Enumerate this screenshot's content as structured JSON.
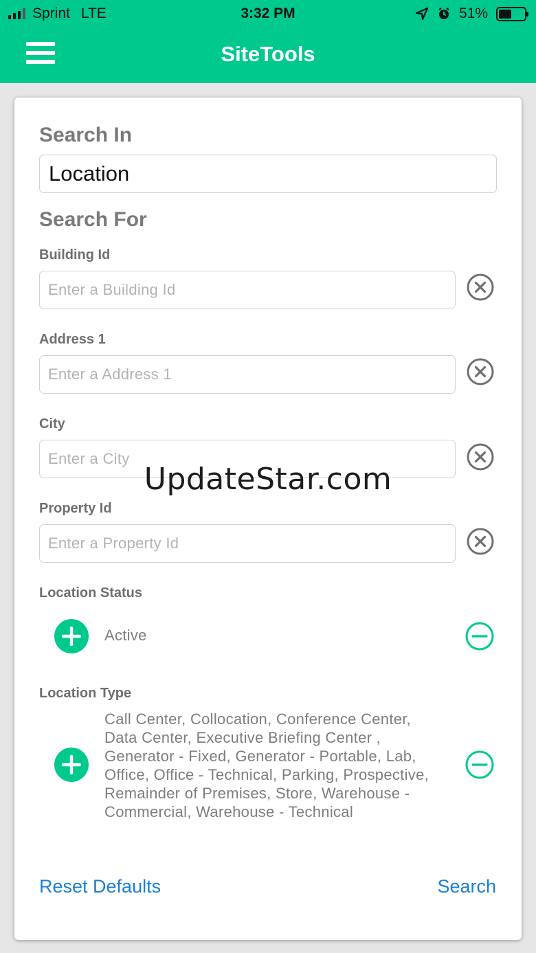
{
  "status_bar": {
    "carrier": "Sprint",
    "network": "LTE",
    "time": "3:32 PM",
    "battery_text": "51%",
    "battery_level": 0.51
  },
  "app": {
    "title": "SiteTools",
    "accent_color": "#00c98e",
    "link_color": "#1a7fd6",
    "menu_icon": "hamburger-menu-icon"
  },
  "search_in": {
    "label": "Search In",
    "value": "Location"
  },
  "search_for": {
    "label": "Search For",
    "fields": [
      {
        "label": "Building Id",
        "placeholder": "Enter a Building Id",
        "value": ""
      },
      {
        "label": "Address 1",
        "placeholder": "Enter a Address 1",
        "value": ""
      },
      {
        "label": "City",
        "placeholder": "Enter a City",
        "value": ""
      },
      {
        "label": "Property Id",
        "placeholder": "Enter a Property Id",
        "value": ""
      }
    ]
  },
  "location_status": {
    "label": "Location Status",
    "value": "Active"
  },
  "location_type": {
    "label": "Location Type",
    "lines": [
      "Call Center, Collocation, Conference Center,",
      "Data Center, Executive Briefing Center ,",
      "Generator - Fixed, Generator - Portable, Lab,",
      "Office, Office - Technical, Parking, Prospective,",
      "Remainder of Premises, Store, Warehouse -",
      "Commercial, Warehouse - Technical"
    ]
  },
  "actions": {
    "reset": "Reset Defaults",
    "search": "Search"
  },
  "watermark": "UpdateStar.com"
}
